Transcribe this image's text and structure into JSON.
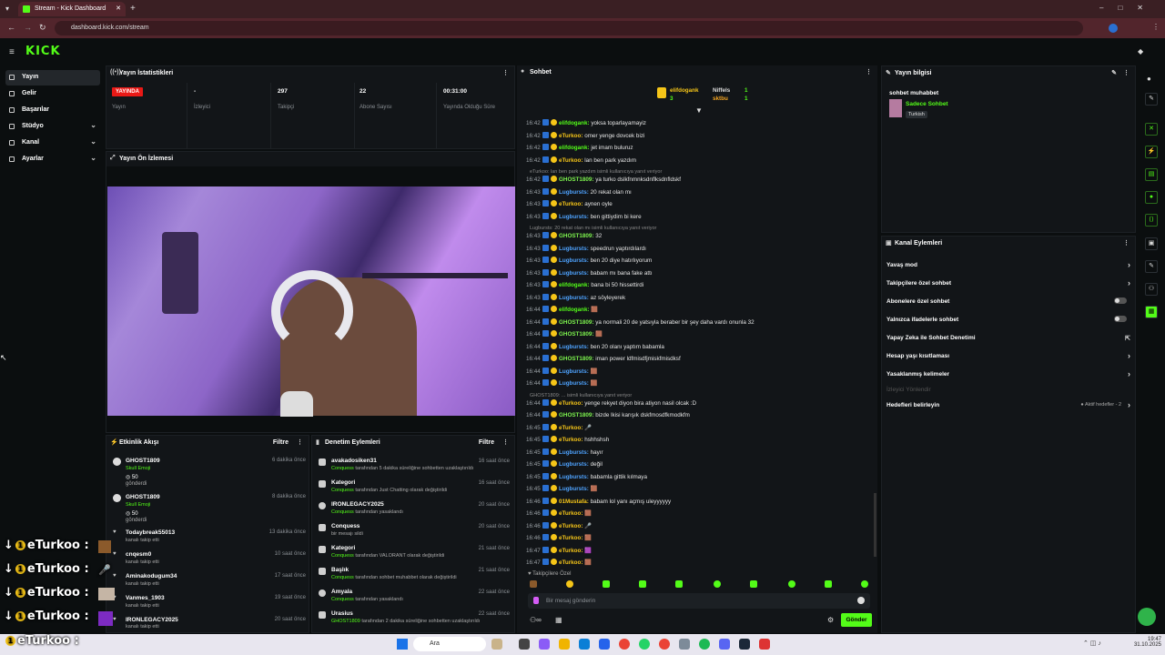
{
  "browser": {
    "tab_title": "Stream - Kick Dashboard",
    "url": "dashboard.kick.com/stream",
    "new_tab": "+"
  },
  "header": {
    "logo": "KICK"
  },
  "sidebar": {
    "items": [
      {
        "label": "Yayın",
        "icon": "broadcast-icon",
        "active": true,
        "chevron": false
      },
      {
        "label": "Gelir",
        "icon": "money-icon",
        "active": false,
        "chevron": false
      },
      {
        "label": "Başarılar",
        "icon": "trophy-icon",
        "active": false,
        "chevron": false
      },
      {
        "label": "Stüdyo",
        "icon": "studio-icon",
        "active": false,
        "chevron": true
      },
      {
        "label": "Kanal",
        "icon": "channel-icon",
        "active": false,
        "chevron": true
      },
      {
        "label": "Ayarlar",
        "icon": "gear-icon",
        "active": false,
        "chevron": true
      }
    ]
  },
  "stats": {
    "title": "Yayın İstatistikleri",
    "items": [
      {
        "value": "YAYINDA",
        "label": "Yayın"
      },
      {
        "value": "-",
        "label": "İzleyici"
      },
      {
        "value": "297",
        "label": "Takipçi"
      },
      {
        "value": "22",
        "label": "Abone Sayısı"
      },
      {
        "value": "00:31:00",
        "label": "Yayında Olduğu Süre"
      }
    ]
  },
  "preview": {
    "title": "Yayın Ön İzlemesi"
  },
  "activity": {
    "title": "Etkinlik Akışı",
    "filter": "Filtre",
    "items": [
      {
        "name": "GHOST1809",
        "sub": "Skull Emoji",
        "amount": "50",
        "note": "gönderdi",
        "time": "6 dakika önce"
      },
      {
        "name": "GHOST1809",
        "sub": "Skull Emoji",
        "amount": "50",
        "note": "gönderdi",
        "time": "8 dakika önce"
      },
      {
        "name": "Todaybreak55013",
        "sub": "kanalı takip etti",
        "time": "13 dakika önce"
      },
      {
        "name": "cnqesm0",
        "sub": "kanalı takip etti",
        "time": "10 saat önce"
      },
      {
        "name": "Aminakodugum34",
        "sub": "kanalı takip etti",
        "time": "17 saat önce"
      },
      {
        "name": "Vanmes_1903",
        "sub": "kanalı takip etti",
        "time": "19 saat önce"
      },
      {
        "name": "IRONLEGACY2025",
        "sub": "kanalı takip etti",
        "time": "20 saat önce"
      }
    ]
  },
  "moderation": {
    "title": "Denetim Eylemleri",
    "filter": "Filtre",
    "items": [
      {
        "name": "avakadosiken31",
        "by": "Conquess",
        "text": "tarafından 5 dakika süreliğine sohbetten uzaklaştırıldı",
        "time": "16 saat önce"
      },
      {
        "name": "Kategori",
        "by": "Conquess",
        "text": "tarafından Just Chatting olarak değiştirildi",
        "time": "16 saat önce"
      },
      {
        "name": "IRONLEGACY2025",
        "by": "Conquess",
        "text": "tarafından yasaklandı",
        "time": "20 saat önce"
      },
      {
        "name": "Conquess",
        "by": "",
        "text": "bir mesajı sildi",
        "time": "20 saat önce"
      },
      {
        "name": "Kategori",
        "by": "Conquess",
        "text": "tarafından VALORANT olarak değiştirildi",
        "time": "21 saat önce"
      },
      {
        "name": "Başlık",
        "by": "Conquess",
        "text": "tarafından sohbet muhabbet olarak değiştirildi",
        "time": "21 saat önce"
      },
      {
        "name": "Amyala",
        "by": "Conquess",
        "text": "tarafından yasaklandı",
        "time": "22 saat önce"
      },
      {
        "name": "Urasius",
        "by": "GHOST1809",
        "text": "tarafından 2 dakika süreliğine sohbetten uzaklaştırıldı",
        "time": "22 saat önce"
      }
    ]
  },
  "chat": {
    "title": "Sohbet",
    "pinned": [
      {
        "name": "elifdogank",
        "count": "3"
      },
      {
        "name": "Niffels",
        "count": "1"
      },
      {
        "name": "sktbu",
        "count": "1"
      }
    ],
    "messages": [
      {
        "time": "16:42",
        "user": "elifdogank",
        "color": "#53fc18",
        "text": "yoksa toparlayamayiz"
      },
      {
        "time": "16:42",
        "user": "eTurkoo",
        "color": "#f5c518",
        "text": "omer yenge dovcek bizi"
      },
      {
        "time": "16:42",
        "user": "elifdogank",
        "color": "#53fc18",
        "text": "jet imam buluruz"
      },
      {
        "time": "16:42",
        "user": "eTurkoo",
        "color": "#f5c518",
        "text": "lan ben park yazdım"
      },
      {
        "reply": "eTurkoo: lan ben park yazdım isimli kullanıcıya yanıt veriyor"
      },
      {
        "time": "16:42",
        "user": "GHOST1809",
        "color": "#7cf24d",
        "text": "ya turko dslkfnmnksdnflksdnfldskf"
      },
      {
        "time": "16:43",
        "user": "Lugbursts",
        "color": "#4ea3ff",
        "text": "20 rekat olan mı"
      },
      {
        "time": "16:43",
        "user": "eTurkoo",
        "color": "#f5c518",
        "text": "aynen oyle"
      },
      {
        "time": "16:43",
        "user": "Lugbursts",
        "color": "#4ea3ff",
        "text": "ben gittiydim bi kere"
      },
      {
        "reply": "Lugbursts: 20 rekat olan mı isimli kullanıcıya yanıt veriyor"
      },
      {
        "time": "16:43",
        "user": "GHOST1809",
        "color": "#7cf24d",
        "text": "32"
      },
      {
        "time": "16:43",
        "user": "Lugbursts",
        "color": "#4ea3ff",
        "text": "speedrun yaptırdılardı"
      },
      {
        "time": "16:43",
        "user": "Lugbursts",
        "color": "#4ea3ff",
        "text": "ben 20 diye hatırlıyorum"
      },
      {
        "time": "16:43",
        "user": "Lugbursts",
        "color": "#4ea3ff",
        "text": "babam mı bana fake attı"
      },
      {
        "time": "16:43",
        "user": "elifdogank",
        "color": "#53fc18",
        "text": "bana bi 50 hissettirdi"
      },
      {
        "time": "16:43",
        "user": "Lugbursts",
        "color": "#4ea3ff",
        "text": "az söyleyerek"
      },
      {
        "time": "16:44",
        "user": "elifdogank",
        "color": "#53fc18",
        "text": "🟫"
      },
      {
        "time": "16:44",
        "user": "GHOST1809",
        "color": "#7cf24d",
        "text": "ya normali 20 de yatsıyla beraber bir şey daha vardı onunla 32"
      },
      {
        "time": "16:44",
        "user": "GHOST1809",
        "color": "#7cf24d",
        "text": "🟫"
      },
      {
        "time": "16:44",
        "user": "Lugbursts",
        "color": "#4ea3ff",
        "text": "ben 20 olanı yaptım babamla"
      },
      {
        "time": "16:44",
        "user": "GHOST1809",
        "color": "#7cf24d",
        "text": "iman power ldfmisdfjmiskfmisdksf"
      },
      {
        "time": "16:44",
        "user": "Lugbursts",
        "color": "#4ea3ff",
        "text": "🟫"
      },
      {
        "time": "16:44",
        "user": "Lugbursts",
        "color": "#4ea3ff",
        "text": "🟫"
      },
      {
        "reply": "GHOST1809: ... isimli kullanıcıya yanıt veriyor"
      },
      {
        "time": "16:44",
        "user": "eTurkoo",
        "color": "#f5c518",
        "text": "yenge rekyet diyon bira atiyon nasil olcak :D"
      },
      {
        "time": "16:44",
        "user": "GHOST1809",
        "color": "#7cf24d",
        "text": "bizde lkisi karışık dskfmosdfkmodkfm"
      },
      {
        "time": "16:45",
        "user": "eTurkoo",
        "color": "#f5c518",
        "text": "🎤"
      },
      {
        "time": "16:45",
        "user": "eTurkoo",
        "color": "#f5c518",
        "text": "hshhshsh"
      },
      {
        "time": "16:45",
        "user": "Lugbursts",
        "color": "#4ea3ff",
        "text": "hayır"
      },
      {
        "time": "16:45",
        "user": "Lugbursts",
        "color": "#4ea3ff",
        "text": "değil"
      },
      {
        "time": "16:45",
        "user": "Lugbursts",
        "color": "#4ea3ff",
        "text": "babamla gittik kılmaya"
      },
      {
        "time": "16:45",
        "user": "Lugbursts",
        "color": "#4ea3ff",
        "text": "🟫"
      },
      {
        "time": "16:46",
        "user": "01Mustafa",
        "color": "#f5c518",
        "text": "babam lol yanı açmış uleyyyyyy"
      },
      {
        "time": "16:46",
        "user": "eTurkoo",
        "color": "#f5c518",
        "text": "🟫"
      },
      {
        "time": "16:46",
        "user": "eTurkoo",
        "color": "#f5c518",
        "text": "🎤"
      },
      {
        "time": "16:46",
        "user": "eTurkoo",
        "color": "#f5c518",
        "text": "🟫"
      },
      {
        "time": "16:47",
        "user": "eTurkoo",
        "color": "#f5c518",
        "text": "🟪"
      },
      {
        "time": "16:47",
        "user": "eTurkoo",
        "color": "#f5c518",
        "text": "🟫"
      }
    ],
    "followers_only": "Takipçilere Özel",
    "input_placeholder": "Bir mesaj gönderin",
    "send": "Gönder"
  },
  "stream_info": {
    "title": "Yayın bilgisi",
    "stream_title": "sohbet muhabbet",
    "category": "Sadece Sohbet",
    "language": "Turkish"
  },
  "channel_actions": {
    "title": "Kanal Eylemleri",
    "items": [
      {
        "label": "Yavaş mod",
        "type": "chevron"
      },
      {
        "label": "Takipçilere özel sohbet",
        "type": "chevron"
      },
      {
        "label": "Abonelere özel sohbet",
        "type": "toggle"
      },
      {
        "label": "Yalnızca ifadelerle sohbet",
        "type": "toggle"
      },
      {
        "label": "Yapay Zeka ile Sohbet Denetimi",
        "type": "external"
      },
      {
        "label": "Hesap yaşı kısıtlaması",
        "type": "chevron"
      },
      {
        "label": "Yasaklanmış kelimeler",
        "type": "chevron"
      },
      {
        "label": "İzleyici Yönlendir",
        "type": "disabled"
      },
      {
        "label": "Hedefleri belirleyin",
        "type": "chevron",
        "badge": "● Aktif hedefler - 2"
      }
    ]
  },
  "overlay": {
    "lines": [
      "eTurkoo :",
      "eTurkoo :",
      "eTurkoo :",
      "eTurkoo :",
      "eTurkoo :"
    ]
  },
  "taskbar": {
    "search": "Ara",
    "time": "19:47",
    "date": "31.10.2025"
  },
  "colors": {
    "brand": "#53fc18",
    "live": "#e91916",
    "background": "#0b0e0f",
    "panel": "#121518"
  }
}
